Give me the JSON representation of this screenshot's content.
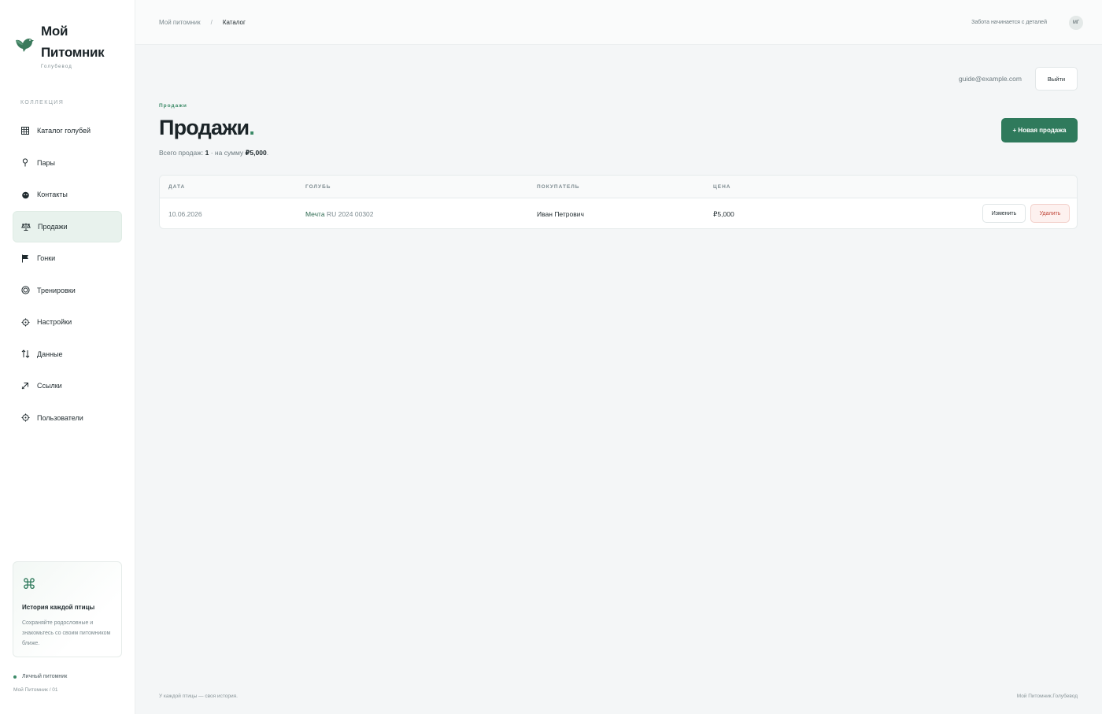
{
  "brand": {
    "title_line1": "Мой",
    "title_line2": "Питомник",
    "subtitle": "Голубевод"
  },
  "sidebar": {
    "section_label": "КОЛЛЕКЦИЯ",
    "items": [
      {
        "label": "Каталог голубей",
        "icon": "grid-icon"
      },
      {
        "label": "Пары",
        "icon": "pin-icon"
      },
      {
        "label": "Контакты",
        "icon": "contacts-icon"
      },
      {
        "label": "Продажи",
        "icon": "scales-icon",
        "active": true
      },
      {
        "label": "Гонки",
        "icon": "flag-icon"
      },
      {
        "label": "Тренировки",
        "icon": "target-icon"
      },
      {
        "label": "Настройки",
        "icon": "gear-icon"
      },
      {
        "label": "Данные",
        "icon": "sort-arrows-icon"
      },
      {
        "label": "Ссылки",
        "icon": "link-arrow-icon"
      },
      {
        "label": "Пользователи",
        "icon": "users-icon"
      }
    ],
    "promo": {
      "title": "История каждой птицы",
      "text": "Сохраняйте родословные и знакомьтесь со своим питомником ближе."
    },
    "status": "Личный питомник",
    "footer": "Мой Питомник / 01"
  },
  "header": {
    "breadcrumb": [
      "Мой питомник",
      "Каталог"
    ],
    "separator": "/",
    "tagline": "Забота начинается с деталей",
    "avatar_initials": "МГ"
  },
  "account": {
    "email": "guide@example.com",
    "logout_label": "Выйти"
  },
  "page": {
    "eyebrow": "Продажи",
    "title": "Продажи",
    "title_dot": ".",
    "summary_prefix": "Всего продаж: ",
    "summary_count": "1",
    "summary_middle": " · на сумму ",
    "summary_total": "₽5,000",
    "summary_suffix": ".",
    "new_sale_label": "+ Новая продажа"
  },
  "table": {
    "headers": {
      "date": "ДАТА",
      "bird": "ГОЛУБЬ",
      "buyer": "ПОКУПАТЕЛЬ",
      "price": "ЦЕНА"
    },
    "rows": [
      {
        "date": "10.06.2026",
        "bird_name": "Мечта",
        "bird_ring": "RU 2024 00302",
        "buyer": "Иван Петрович",
        "price": "₽5,000",
        "edit_label": "Изменить",
        "delete_label": "Удалить"
      }
    ]
  },
  "footer": {
    "left": "У каждой птицы — своя история.",
    "right": "Мой Питомник.Голубевод"
  },
  "colors": {
    "accent": "#2f7a5c",
    "danger": "#c0473a",
    "active_bg": "#e8f2ed"
  }
}
